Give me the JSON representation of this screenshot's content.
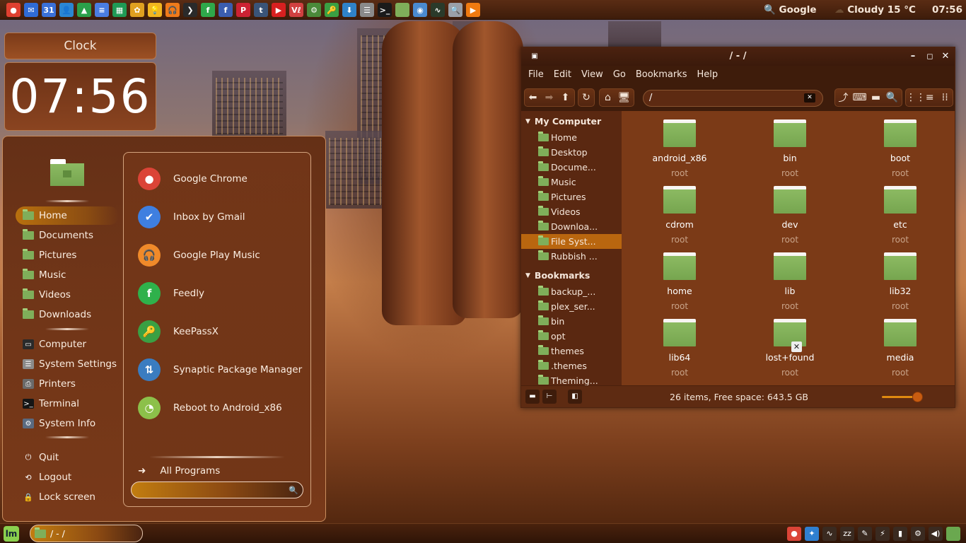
{
  "top_panel": {
    "launchers": [
      {
        "icon": "chrome-icon",
        "color": "#e04030",
        "glyph": "●"
      },
      {
        "icon": "mail-icon",
        "color": "#2f6bd6",
        "glyph": "✉"
      },
      {
        "icon": "calendar-icon",
        "color": "#3a70d8",
        "glyph": "31"
      },
      {
        "icon": "contacts-icon",
        "color": "#2b86d2",
        "glyph": "👤"
      },
      {
        "icon": "drive-icon",
        "color": "#2ba04a",
        "glyph": "▲"
      },
      {
        "icon": "docs-icon",
        "color": "#4a7de0",
        "glyph": "≡"
      },
      {
        "icon": "sheets-icon",
        "color": "#1f9a55",
        "glyph": "▦"
      },
      {
        "icon": "photos-icon",
        "color": "#e0a020",
        "glyph": "✿"
      },
      {
        "icon": "keep-icon",
        "color": "#f2b620",
        "glyph": "💡"
      },
      {
        "icon": "play-music-icon",
        "color": "#f07a1a",
        "glyph": "🎧"
      },
      {
        "icon": "plex-icon",
        "color": "#2a2a2a",
        "glyph": "❯"
      },
      {
        "icon": "feedly-icon",
        "color": "#2fa84a",
        "glyph": "f"
      },
      {
        "icon": "facebook-icon",
        "color": "#3b5db0",
        "glyph": "f"
      },
      {
        "icon": "pinterest-icon",
        "color": "#cc2233",
        "glyph": "P"
      },
      {
        "icon": "tumblr-icon",
        "color": "#3a5478",
        "glyph": "t"
      },
      {
        "icon": "youtube-icon",
        "color": "#d82020",
        "glyph": "▶"
      },
      {
        "icon": "vivaldi-icon",
        "color": "#d04040",
        "glyph": "Vℓ"
      },
      {
        "icon": "settings-icon",
        "color": "#4a8a3a",
        "glyph": "⚙"
      },
      {
        "icon": "keepassx-icon",
        "color": "#3aa043",
        "glyph": "🔑"
      },
      {
        "icon": "download-icon",
        "color": "#2f82c8",
        "glyph": "⬇"
      },
      {
        "icon": "system-settings-icon",
        "color": "#8a8a8a",
        "glyph": "☰"
      },
      {
        "icon": "terminal-icon",
        "color": "#1a1a1a",
        "glyph": ">_"
      },
      {
        "icon": "folder-icon",
        "color": "#7fae5a",
        "glyph": ""
      },
      {
        "icon": "camera-icon",
        "color": "#4a8ad0",
        "glyph": "◉"
      },
      {
        "icon": "system-monitor-icon",
        "color": "#2a3a2a",
        "glyph": "∿"
      },
      {
        "icon": "search-app-icon",
        "color": "#9aa0a8",
        "glyph": "🔍"
      },
      {
        "icon": "vlc-icon",
        "color": "#f07a10",
        "glyph": "▶"
      }
    ],
    "search_label": "Google",
    "weather": "Cloudy 15 °C",
    "clock": "07:56"
  },
  "clock_desklet": {
    "title": "Clock",
    "time": "07:56"
  },
  "menu": {
    "places": [
      {
        "label": "Home",
        "name": "menu-place-home",
        "active": true
      },
      {
        "label": "Documents",
        "name": "menu-place-documents"
      },
      {
        "label": "Pictures",
        "name": "menu-place-pictures"
      },
      {
        "label": "Music",
        "name": "menu-place-music"
      },
      {
        "label": "Videos",
        "name": "menu-place-videos"
      },
      {
        "label": "Downloads",
        "name": "menu-place-downloads"
      }
    ],
    "system": [
      {
        "label": "Computer",
        "name": "menu-system-computer",
        "icon": "monitor-icon",
        "color": "#2a2a2a",
        "glyph": "▭"
      },
      {
        "label": "System Settings",
        "name": "menu-system-settings",
        "icon": "system-settings-icon",
        "color": "#8a8a8a",
        "glyph": "☰"
      },
      {
        "label": "Printers",
        "name": "menu-system-printers",
        "icon": "printer-icon",
        "color": "#6a6a6a",
        "glyph": "⎙"
      },
      {
        "label": "Terminal",
        "name": "menu-system-terminal",
        "icon": "terminal-icon",
        "color": "#151515",
        "glyph": ">_"
      },
      {
        "label": "System Info",
        "name": "menu-system-info",
        "icon": "gear-icon",
        "color": "#5a6a80",
        "glyph": "⚙"
      }
    ],
    "session": [
      {
        "label": "Quit",
        "name": "menu-session-quit",
        "icon": "power-icon",
        "glyph": "⏻"
      },
      {
        "label": "Logout",
        "name": "menu-session-logout",
        "icon": "logout-icon",
        "glyph": "⟲"
      },
      {
        "label": "Lock screen",
        "name": "menu-session-lock",
        "icon": "lock-icon",
        "glyph": "🔒"
      }
    ],
    "favorites": [
      {
        "label": "Google Chrome",
        "name": "fav-google-chrome",
        "icon": "chrome-icon",
        "color": "#db4437",
        "glyph": "●"
      },
      {
        "label": "Inbox by Gmail",
        "name": "fav-inbox-gmail",
        "icon": "inbox-icon",
        "color": "#3f7fe0",
        "glyph": "✔"
      },
      {
        "label": "Google Play Music",
        "name": "fav-play-music",
        "icon": "play-music-icon",
        "color": "#f08a2a",
        "glyph": "🎧"
      },
      {
        "label": "Feedly",
        "name": "fav-feedly",
        "icon": "feedly-icon",
        "color": "#2fb14b",
        "glyph": "f"
      },
      {
        "label": "KeePassX",
        "name": "fav-keepassx",
        "icon": "keepassx-icon",
        "color": "#3aa043",
        "glyph": "🔑"
      },
      {
        "label": "Synaptic Package Manager",
        "name": "fav-synaptic",
        "icon": "synaptic-icon",
        "color": "#3a7cc0",
        "glyph": "⇅"
      },
      {
        "label": "Reboot to Android_x86",
        "name": "fav-reboot-android",
        "icon": "android-icon",
        "color": "#8cc04a",
        "glyph": "◔"
      }
    ],
    "all_programs": "All Programs",
    "search_value": ""
  },
  "file_manager": {
    "title": "/ - /",
    "menubar": [
      "File",
      "Edit",
      "View",
      "Go",
      "Bookmarks",
      "Help"
    ],
    "address": "/",
    "sidebar": {
      "computer_header": "My Computer",
      "computer_items": [
        {
          "label": "Home"
        },
        {
          "label": "Desktop"
        },
        {
          "label": "Docume..."
        },
        {
          "label": "Music"
        },
        {
          "label": "Pictures"
        },
        {
          "label": "Videos"
        },
        {
          "label": "Downloa..."
        },
        {
          "label": "File Syst...",
          "selected": true
        },
        {
          "label": "Rubbish ..."
        }
      ],
      "bookmarks_header": "Bookmarks",
      "bookmark_items": [
        {
          "label": "backup_..."
        },
        {
          "label": "plex_ser..."
        },
        {
          "label": "bin"
        },
        {
          "label": "opt"
        },
        {
          "label": "themes"
        },
        {
          "label": ".themes"
        },
        {
          "label": "Theming..."
        }
      ]
    },
    "items": [
      {
        "name": "android_x86",
        "owner": "root"
      },
      {
        "name": "bin",
        "owner": "root"
      },
      {
        "name": "boot",
        "owner": "root"
      },
      {
        "name": "cdrom",
        "owner": "root"
      },
      {
        "name": "dev",
        "owner": "root"
      },
      {
        "name": "etc",
        "owner": "root"
      },
      {
        "name": "home",
        "owner": "root"
      },
      {
        "name": "lib",
        "owner": "root"
      },
      {
        "name": "lib32",
        "owner": "root"
      },
      {
        "name": "lib64",
        "owner": "root"
      },
      {
        "name": "lost+found",
        "owner": "root",
        "locked": true
      },
      {
        "name": "media",
        "owner": "root"
      }
    ],
    "status": "26 items, Free space: 643.5 GB"
  },
  "bottom_panel": {
    "window_button": "/ - /",
    "tray": [
      {
        "icon": "chrome-tray-icon",
        "color": "#db4437",
        "glyph": "●"
      },
      {
        "icon": "dropbox-tray-icon",
        "color": "#2f7fd0",
        "glyph": "✦"
      },
      {
        "icon": "system-monitor-tray-icon",
        "color": "#3a2a20",
        "glyph": "∿"
      },
      {
        "icon": "sleep-tray-icon",
        "color": "#3a2a20",
        "glyph": "zz"
      },
      {
        "icon": "pen-tray-icon",
        "color": "#3a2a20",
        "glyph": "✎"
      },
      {
        "icon": "plug-tray-icon",
        "color": "#3a2a20",
        "glyph": "⚡"
      },
      {
        "icon": "battery-tray-icon",
        "color": "#3a2a20",
        "glyph": "▮"
      },
      {
        "icon": "network-tray-icon",
        "color": "#3a2a20",
        "glyph": "⚙"
      },
      {
        "icon": "volume-tray-icon",
        "color": "#3a2a20",
        "glyph": "◀)"
      },
      {
        "icon": "show-desktop-icon",
        "color": "#6aa84f",
        "glyph": ""
      }
    ]
  }
}
